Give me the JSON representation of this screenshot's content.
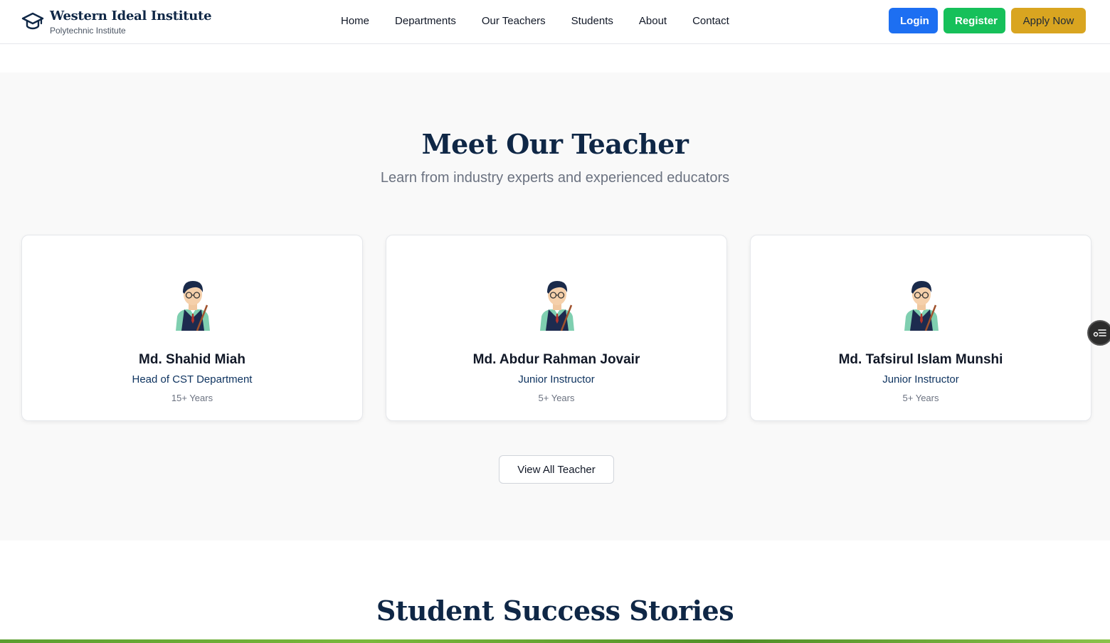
{
  "brand": {
    "name": "Western Ideal Institute",
    "subtitle": "Polytechnic Institute",
    "icon": "graduation-cap-icon"
  },
  "nav": {
    "items": [
      "Home",
      "Departments",
      "Our Teachers",
      "Students",
      "About",
      "Contact"
    ]
  },
  "actions": {
    "login": "Login",
    "register": "Register",
    "apply": "Apply Now"
  },
  "colors": {
    "login": "#1d6ff2",
    "register": "#16c05a",
    "apply": "#d9a520",
    "heading": "#0f2746"
  },
  "teachers": {
    "title": "Meet Our Teacher",
    "subtitle": "Learn from industry experts and experienced educators",
    "cards": [
      {
        "name": "Md. Shahid Miah",
        "role": "Head of CST Department",
        "experience": "15+ Years"
      },
      {
        "name": "Md. Abdur Rahman Jovair",
        "role": "Junior Instructor",
        "experience": "5+ Years"
      },
      {
        "name": "Md. Tafsirul Islam Munshi",
        "role": "Junior Instructor",
        "experience": "5+ Years"
      }
    ],
    "view_all": "View All Teacher"
  },
  "stories": {
    "title": "Student Success Stories"
  },
  "floating": {
    "icon": "accessibility-menu-icon"
  }
}
